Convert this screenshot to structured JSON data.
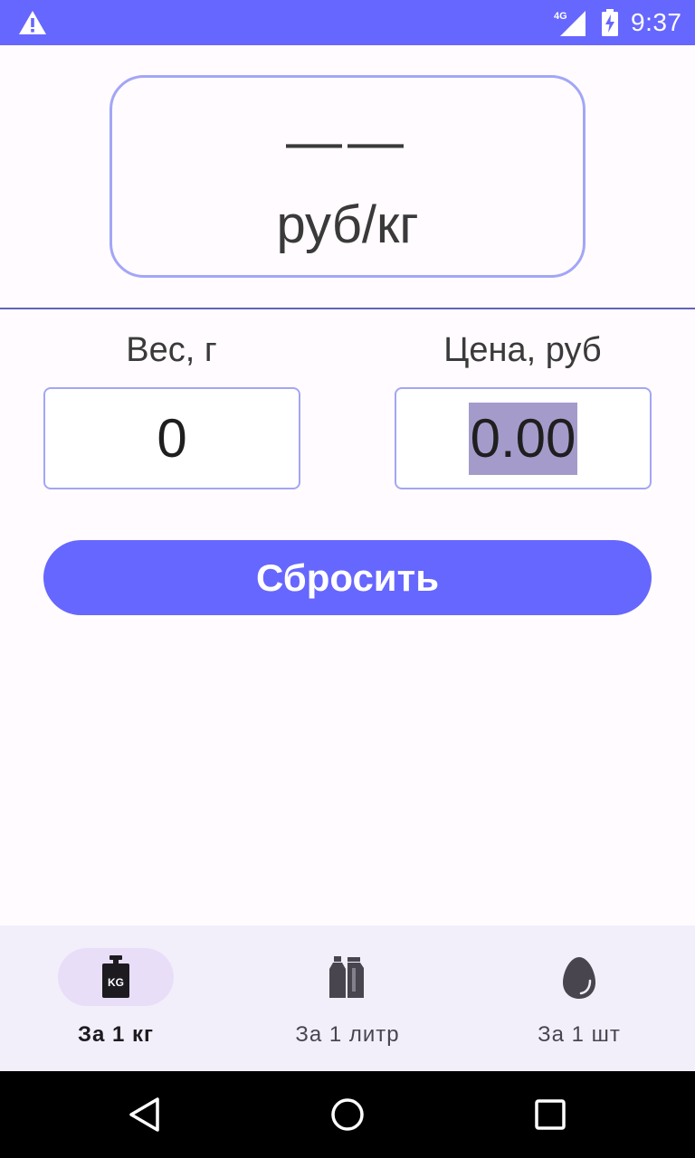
{
  "status_bar": {
    "network": "4G",
    "time": "9:37",
    "icons": [
      "warning-icon",
      "signal-icon",
      "battery-charging-icon"
    ]
  },
  "result": {
    "value": "——",
    "unit": "руб/кг"
  },
  "inputs": {
    "weight": {
      "label": "Вес, г",
      "value": "0"
    },
    "price": {
      "label": "Цена, руб",
      "value": "0.00"
    }
  },
  "reset_button": {
    "label": "Сбросить"
  },
  "bottom_nav": {
    "items": [
      {
        "label": "За 1 кг",
        "icon": "weight-kg-icon",
        "active": true,
        "icon_text": "KG"
      },
      {
        "label": "За 1 литр",
        "icon": "bottles-icon",
        "active": false
      },
      {
        "label": "За 1 шт",
        "icon": "egg-icon",
        "active": false
      }
    ]
  },
  "system_nav": {
    "buttons": [
      "back-icon",
      "home-icon",
      "recents-icon"
    ]
  },
  "colors": {
    "accent": "#6667fe",
    "card_border": "#a3a6f6",
    "nav_background": "#f2effb",
    "active_pill": "#e8def8"
  }
}
